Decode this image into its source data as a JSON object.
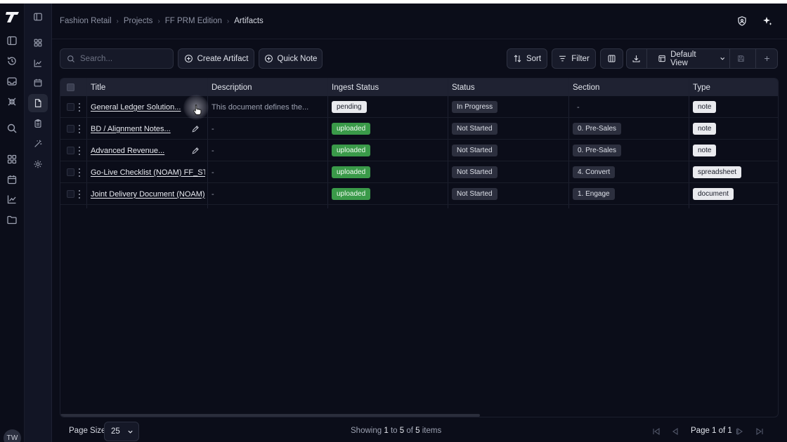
{
  "breadcrumb": [
    "Fashion Retail",
    "Projects",
    "FF PRM Edition",
    "Artifacts"
  ],
  "toolbar": {
    "search_placeholder": "Search...",
    "create_label": "Create Artifact",
    "quick_note_label": "Quick Note",
    "sort_label": "Sort",
    "filter_label": "Filter",
    "view_label": "Default View"
  },
  "columns": [
    "Title",
    "Description",
    "Ingest Status",
    "Status",
    "Section",
    "Type"
  ],
  "rows": [
    {
      "title": "General Ledger Solution...",
      "description": "This document defines the...",
      "ingest": "pending",
      "status": "In Progress",
      "section": "-",
      "type": "note"
    },
    {
      "title": "BD / Alignment Notes...",
      "description": "-",
      "ingest": "uploaded",
      "status": "Not Started",
      "section": "0. Pre-Sales",
      "type": "note"
    },
    {
      "title": "Advanced Revenue...",
      "description": "-",
      "ingest": "uploaded",
      "status": "Not Started",
      "section": "0. Pre-Sales",
      "type": "note"
    },
    {
      "title": "Go-Live Checklist (NOAM) FF_ST...",
      "description": "-",
      "ingest": "uploaded",
      "status": "Not Started",
      "section": "4. Convert",
      "type": "spreadsheet"
    },
    {
      "title": "Joint Delivery Document (NOAM)",
      "description": "-",
      "ingest": "uploaded",
      "status": "Not Started",
      "section": "1. Engage",
      "type": "document"
    }
  ],
  "footer": {
    "page_size_label": "Page Size",
    "page_size_value": "25",
    "showing_prefix": "Showing",
    "showing_from": "1",
    "showing_to_word": "to",
    "showing_to": "5",
    "showing_of_word": "of",
    "showing_total": "5",
    "showing_suffix": "items",
    "page_text": "Page 1 of 1"
  },
  "user": {
    "initials": "TW"
  },
  "colors": {
    "background": "#0b0d19",
    "sidebar": "#121525",
    "uploaded": "#3a9a49",
    "header_row": "#1f2232"
  }
}
